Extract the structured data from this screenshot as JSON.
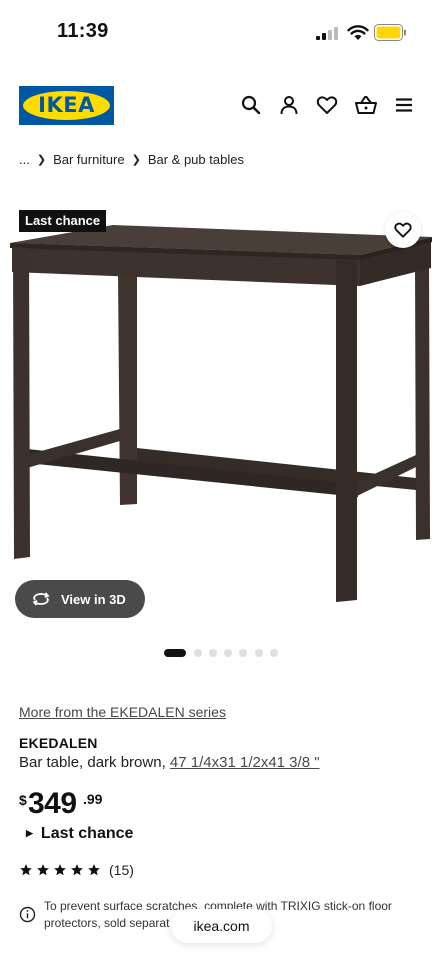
{
  "status_bar": {
    "time": "11:39"
  },
  "header": {
    "logo_text": "IKEA",
    "brand_colors": {
      "blue": "#0058a3",
      "yellow": "#ffdb00"
    },
    "icons": [
      "search-icon",
      "user-icon",
      "heart-icon",
      "cart-icon",
      "menu-icon"
    ]
  },
  "breadcrumb": {
    "ellipsis": "...",
    "items": [
      "Bar furniture",
      "Bar & pub tables"
    ]
  },
  "gallery": {
    "badge": "Last chance",
    "view_3d_label": "View in 3D",
    "image_count": 7,
    "active_index": 0
  },
  "product": {
    "series_link": "More from the EKEDALEN series",
    "name": "EKEDALEN",
    "description": "Bar table, dark brown, ",
    "dimensions": "47 1/4x31 1/2x41 3/8 \"",
    "price": {
      "currency": "$",
      "integer": "349",
      "decimal": ".99"
    },
    "availability": "Last chance",
    "rating": {
      "stars": 5,
      "count": "(15)"
    },
    "info_note": "To prevent surface scratches, complete with TRIXIG stick-on floor protectors, sold separat"
  },
  "browser": {
    "url": "ikea.com"
  }
}
